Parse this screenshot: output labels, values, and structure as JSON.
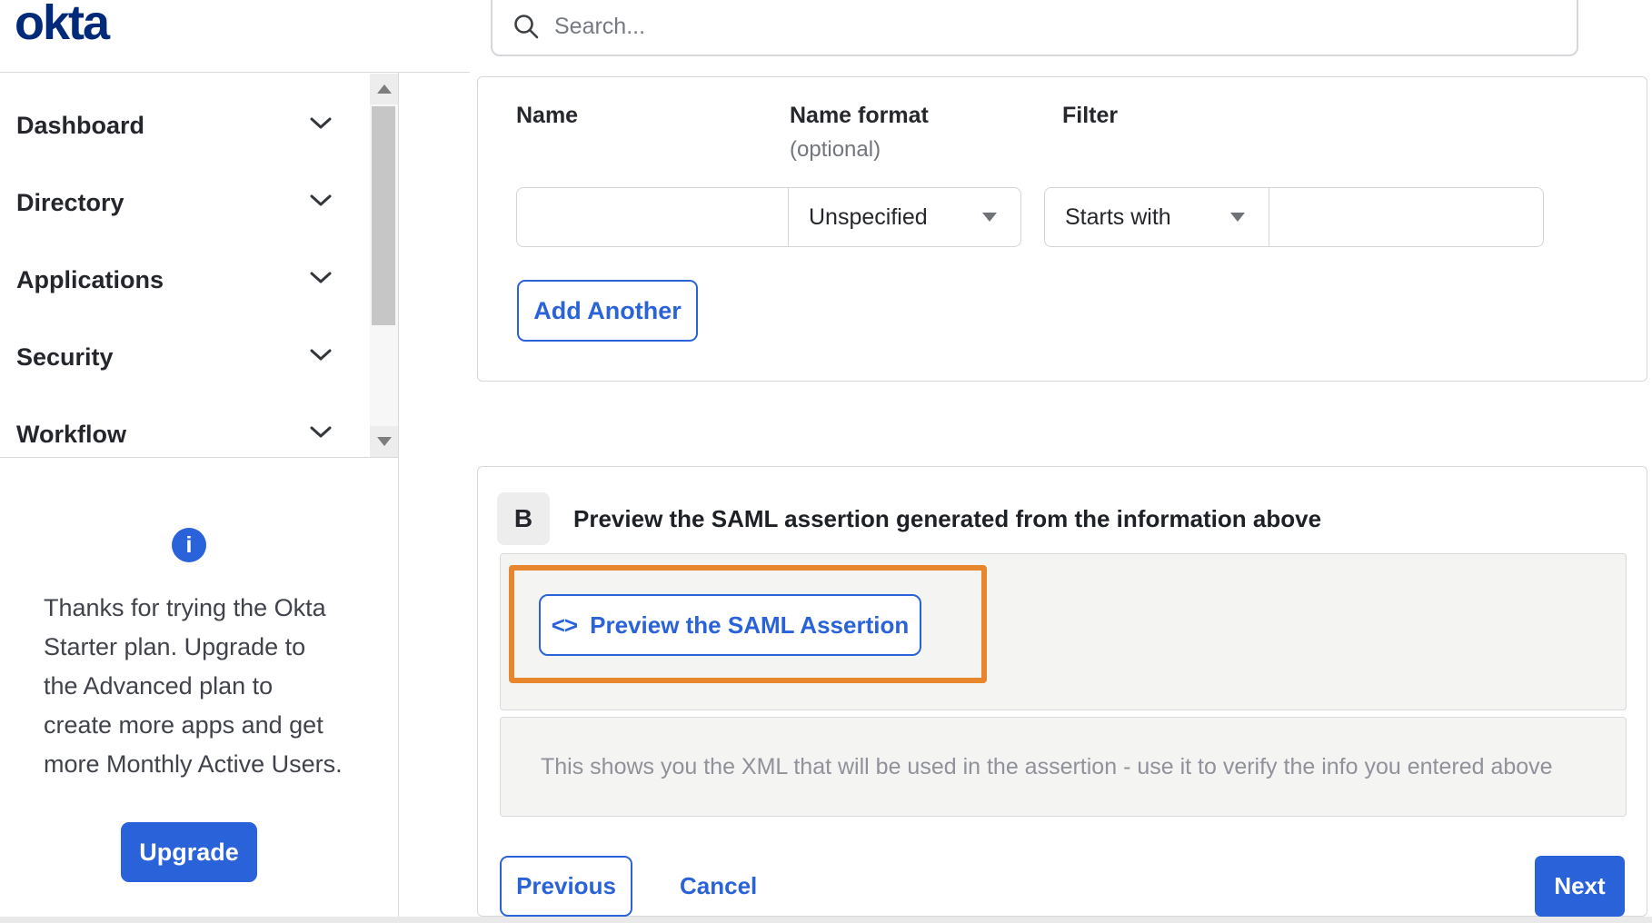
{
  "brand": {
    "logo_text": "okta"
  },
  "topbar": {
    "search_placeholder": "Search..."
  },
  "sidebar": {
    "items": [
      {
        "label": "Dashboard"
      },
      {
        "label": "Directory"
      },
      {
        "label": "Applications"
      },
      {
        "label": "Security"
      },
      {
        "label": "Workflow"
      }
    ]
  },
  "promo": {
    "lines": [
      "Thanks for trying the Okta",
      "Starter plan. Upgrade to",
      "the Advanced plan to",
      "create more apps and get",
      "more Monthly Active Users."
    ],
    "upgrade_label": "Upgrade"
  },
  "attribute_form": {
    "headers": {
      "name": "Name",
      "name_format": "Name format",
      "name_format_note": "(optional)",
      "filter": "Filter"
    },
    "name_value": "",
    "name_format_selected": "Unspecified",
    "filter_type_selected": "Starts with",
    "filter_value": "",
    "add_another_label": "Add Another"
  },
  "section_b": {
    "badge": "B",
    "heading": "Preview the SAML assertion generated from the information above",
    "preview_icon": "<>",
    "preview_button_label": "Preview the SAML Assertion",
    "note": "This shows you the XML that will be used in the assertion - use it to verify the info you entered above"
  },
  "footer": {
    "previous_label": "Previous",
    "cancel_label": "Cancel",
    "next_label": "Next"
  },
  "colors": {
    "accent_blue": "#2a62d9",
    "logo_navy": "#00297a",
    "annotation_orange": "#e8862d",
    "panel_gray": "#f4f4f3",
    "border_gray": "#d8d8dc"
  }
}
